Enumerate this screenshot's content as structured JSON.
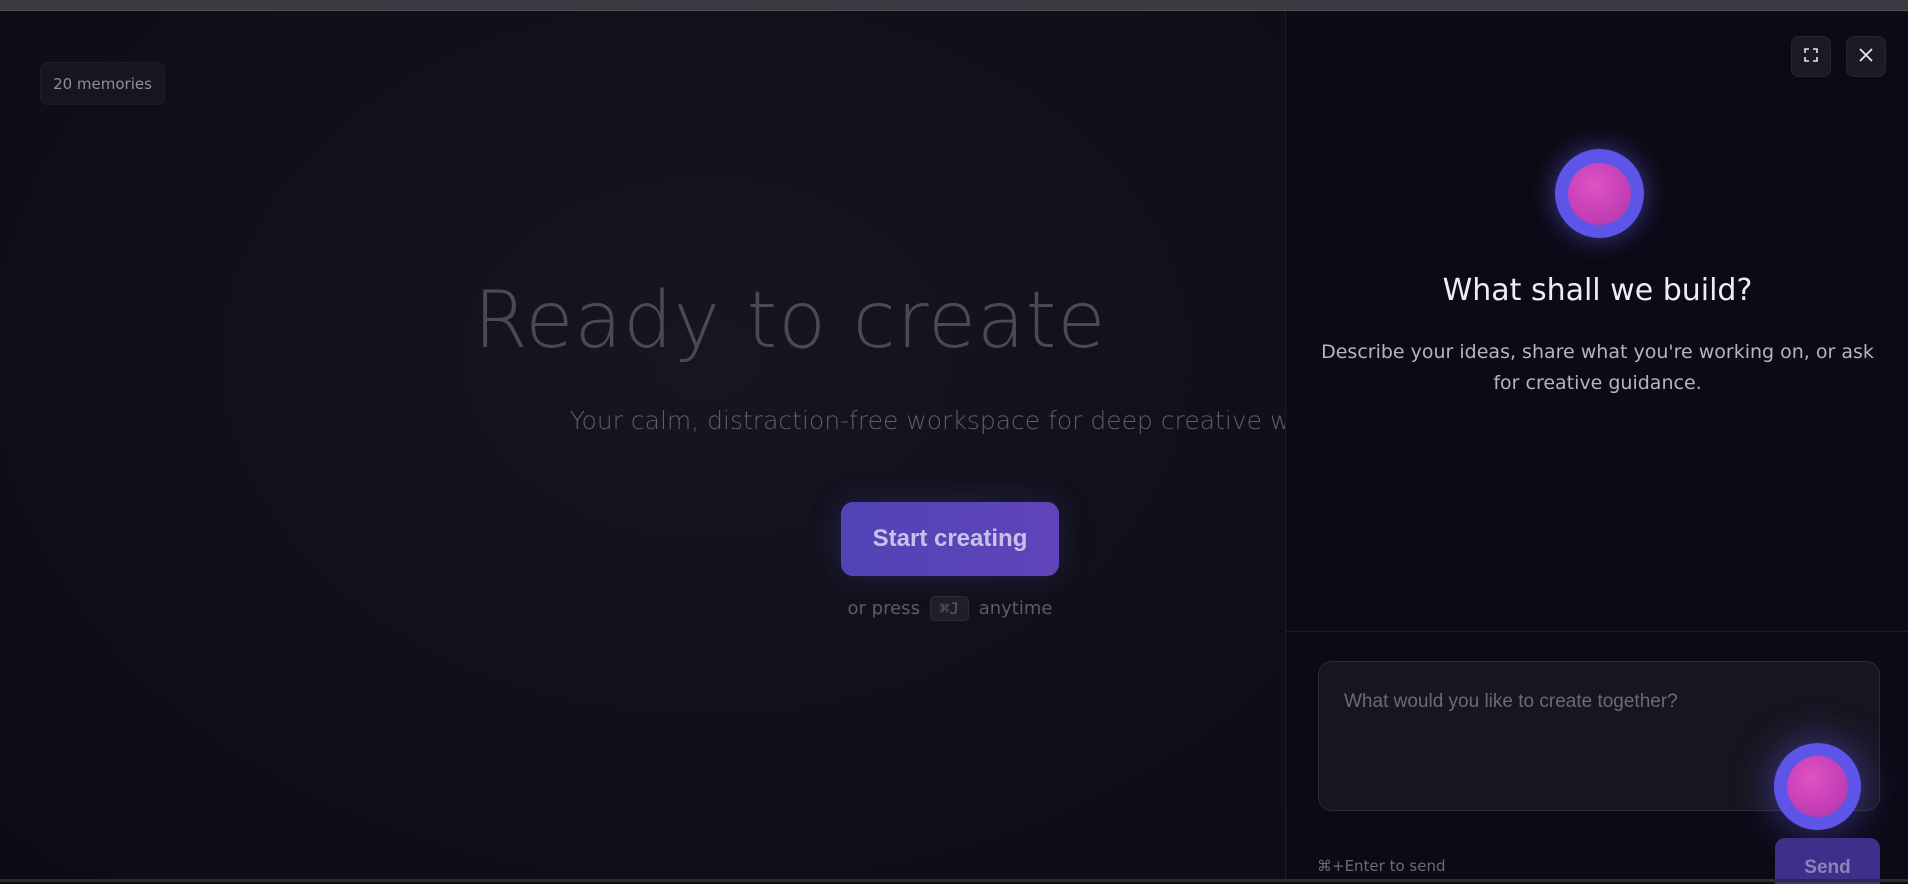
{
  "main": {
    "memories_badge": "20 memories",
    "hero_title": "Ready to create",
    "hero_subtitle": "Your calm, distraction-free workspace for deep creative work",
    "start_button": "Start creating",
    "press_prefix": "or press",
    "shortcut": "⌘J",
    "press_suffix": "anytime"
  },
  "panel": {
    "expand_icon": "expand-icon",
    "close_icon": "close-icon",
    "title": "What shall we build?",
    "description": "Describe your ideas, share what you're working on, or ask for creative guidance.",
    "input_placeholder": "What would you like to create together?",
    "input_value": "",
    "send_hint": "⌘+Enter to send",
    "send_button": "Send"
  },
  "colors": {
    "accent": "#5144b6",
    "orb_outer": "#5c55e8",
    "orb_inner": "#c640b8",
    "background": "#0d0d16"
  }
}
